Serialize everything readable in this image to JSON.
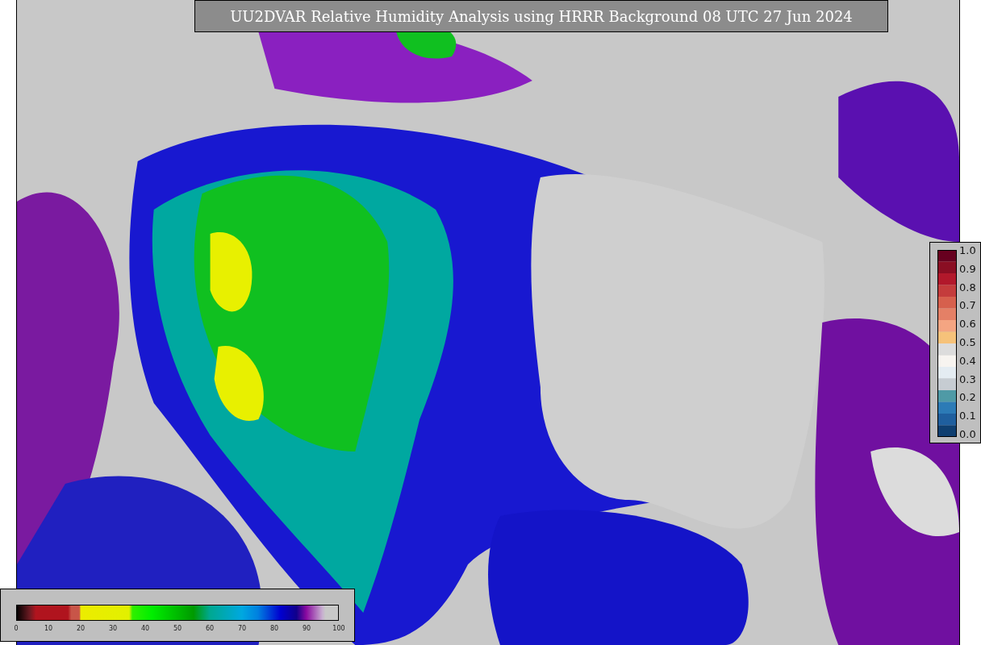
{
  "title": "UU2DVAR Relative Humidity Analysis using HRRR Background 08 UTC 27 Jun 2024",
  "humidity_legend": {
    "ticks": [
      "0",
      "10",
      "20",
      "30",
      "40",
      "50",
      "60",
      "70",
      "80",
      "90",
      "100"
    ]
  },
  "observation_legend": {
    "ticks": [
      "1.0",
      "0.9",
      "0.8",
      "0.7",
      "0.6",
      "0.5",
      "0.4",
      "0.3",
      "0.2",
      "0.1",
      "0.0"
    ]
  }
}
